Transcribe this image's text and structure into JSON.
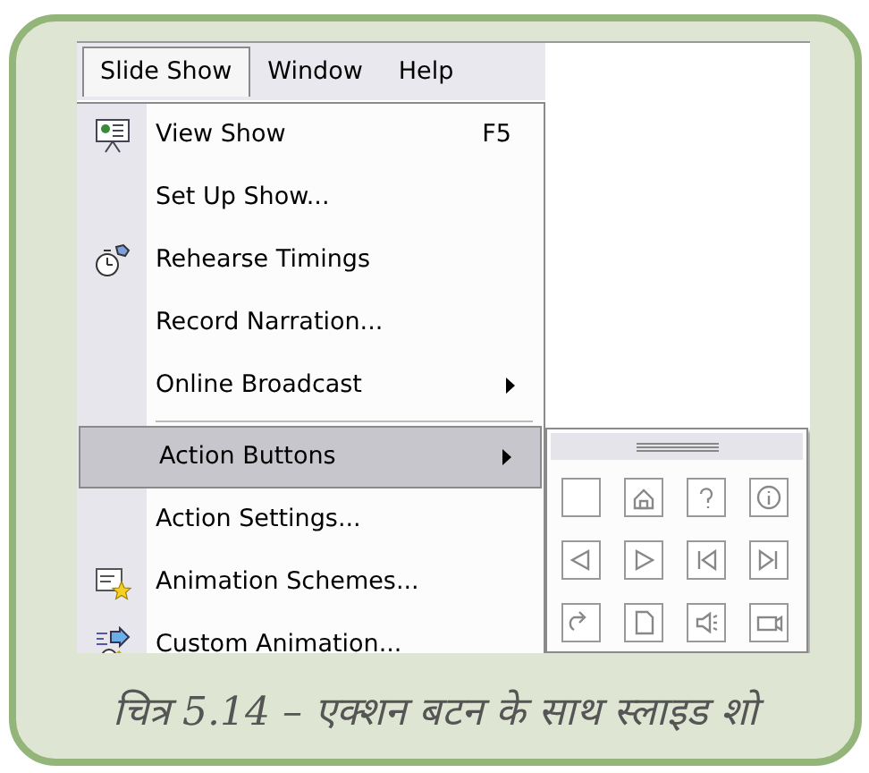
{
  "menu_bar": [
    {
      "label": "Slide Show",
      "selected": true
    },
    {
      "label": "Window",
      "selected": false
    },
    {
      "label": "Help",
      "selected": false
    }
  ],
  "menu_items": [
    {
      "label": "View Show",
      "shortcut": "F5",
      "submenu": false,
      "selected": false
    },
    {
      "label": "Set Up Show...",
      "submenu": false,
      "selected": false
    },
    {
      "label": "Rehearse Timings",
      "submenu": false,
      "selected": false
    },
    {
      "label": "Record Narration...",
      "submenu": false,
      "selected": false
    },
    {
      "label": "Online Broadcast",
      "submenu": true,
      "selected": false,
      "separator_after": true
    },
    {
      "label": "Action Buttons",
      "submenu": true,
      "selected": true
    },
    {
      "label": "Action Settings...",
      "submenu": false,
      "selected": false
    },
    {
      "label": "Animation Schemes...",
      "submenu": false,
      "selected": false
    },
    {
      "label": "Custom Animation...",
      "submenu": false,
      "selected": false
    }
  ],
  "caption": "चित्र 5.14 – एक्शन बटन के साथ स्लाइड शो"
}
